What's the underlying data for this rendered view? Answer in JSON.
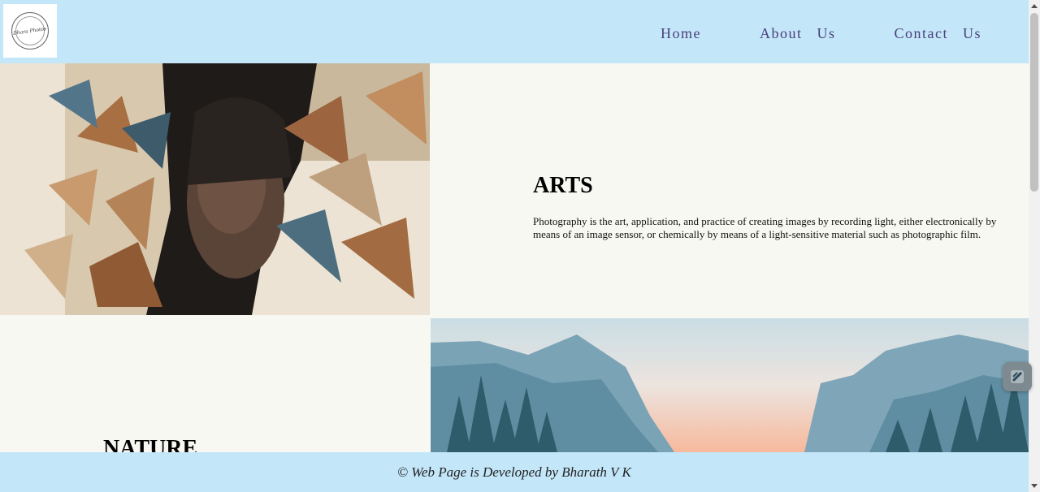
{
  "header": {
    "logo": {
      "script_text": "Dhara Photos",
      "icon": "photography-logo-icon"
    },
    "nav": [
      {
        "label": "Home"
      },
      {
        "label": "About  Us"
      },
      {
        "label": "Contact  Us"
      }
    ]
  },
  "sections": [
    {
      "title": "ARTS",
      "description": "Photography is the art, application, and practice of creating images by recording light, either electronically by means of an image sensor, or chemically by means of a light-sensitive material such as photographic film.",
      "image": "paper-collage-portrait-image"
    },
    {
      "title": "NATURE",
      "image": "mountain-forest-landscape-image"
    }
  ],
  "footer": {
    "text": "© Web Page is Developed by Bharath V K"
  },
  "widgets": {
    "floating": "floating-extension-icon"
  },
  "colors": {
    "header_bg": "#c3e6f9",
    "nav_text": "#4a3f7a",
    "page_bg": "#f8f8f3"
  }
}
